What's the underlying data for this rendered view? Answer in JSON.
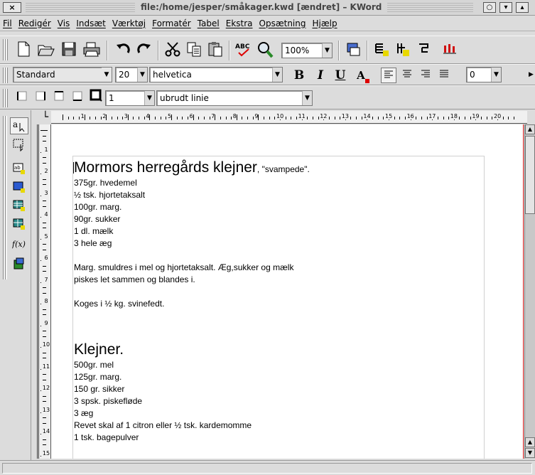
{
  "window": {
    "title": "file:/home/jesper/småkager.kwd [ændret] – KWord",
    "close_glyph": "×",
    "controls": [
      "○",
      "▾",
      "▴"
    ]
  },
  "menubar": [
    "Fil",
    "Redigér",
    "Vis",
    "Indsæt",
    "Værktøj",
    "Formatér",
    "Tabel",
    "Ekstra",
    "Opsætning",
    "Hjælp"
  ],
  "toolbar_main": {
    "zoom": "100%",
    "icons": [
      "new-icon",
      "open-icon",
      "save-icon",
      "print-icon",
      "undo-icon",
      "redo-icon",
      "cut-icon",
      "copy-icon",
      "paste-icon",
      "spellcheck-icon",
      "find-icon",
      "zoom-combo",
      "formula-icon",
      "table-icon",
      "picture-icon",
      "part-icon",
      "chart-icon"
    ]
  },
  "toolbar_format": {
    "style": "Standard",
    "size": "20",
    "font": "helvetica",
    "bold": "B",
    "italic": "I",
    "underline": "U",
    "color_label": "A",
    "spacing": "0"
  },
  "toolbar_frame": {
    "border_width": "1",
    "border_style": "ubrudt linie"
  },
  "ruler": {
    "h_labels": [
      "1",
      "2",
      "3",
      "4",
      "5",
      "6",
      "7",
      "8",
      "9",
      "10",
      "11",
      "12",
      "13",
      "14",
      "15",
      "16",
      "17",
      "18",
      "19",
      "20"
    ],
    "v_labels": [
      "1",
      "2",
      "3",
      "4",
      "5",
      "6",
      "7",
      "8",
      "9",
      "10",
      "11",
      "12",
      "13",
      "14",
      "15"
    ]
  },
  "document": {
    "title1": "Mormors herregårds klejner",
    "title1_suffix": ", \"svampede\".",
    "ingredients1": [
      "375gr. hvedemel",
      "½ tsk. hjortetaksalt",
      "100gr. marg.",
      "90gr. sukker",
      "1 dl. mælk",
      "3 hele æg"
    ],
    "method1": [
      "Marg. smuldres i mel og hjortetaksalt. Æg,sukker og mælk",
      "piskes let sammen og blandes i."
    ],
    "method2": "Koges i ½ kg. svinefedt.",
    "title2": "Klejner.",
    "ingredients2": [
      "500gr. mel",
      "125gr. marg.",
      "150 gr. sikker",
      "3 spsk. piskefløde",
      "3 æg",
      "Revet skal af 1 citron eller ½ tsk. kardemomme",
      "1 tsk. bagepulver"
    ]
  }
}
